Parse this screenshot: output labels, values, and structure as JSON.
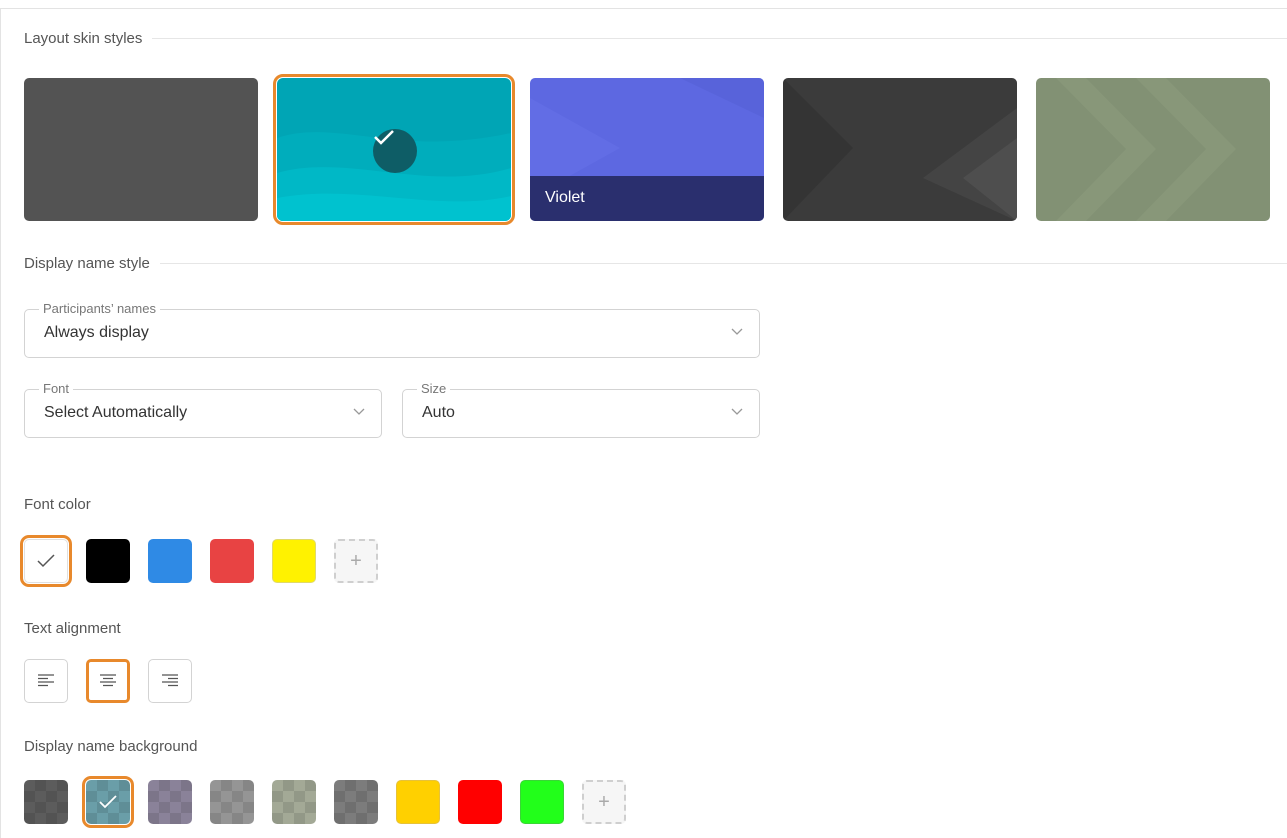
{
  "sections": {
    "layout_skin_styles": "Layout skin styles",
    "display_name_style": "Display name style",
    "font_color": "Font color",
    "text_alignment": "Text alignment",
    "display_name_background": "Display name background"
  },
  "skins": [
    {
      "color": "#535353",
      "selected": false,
      "caption": ""
    },
    {
      "color": "#00a5b5",
      "selected": true,
      "caption": ""
    },
    {
      "color": "#5d68e1",
      "selected": false,
      "caption": "Violet"
    },
    {
      "color": "#3b3b3b",
      "selected": false,
      "caption": ""
    },
    {
      "color": "#829174",
      "selected": false,
      "caption": ""
    }
  ],
  "participants_names": {
    "legend": "Participants’ names",
    "value": "Always display"
  },
  "font": {
    "legend": "Font",
    "value": "Select Automatically"
  },
  "size": {
    "legend": "Size",
    "value": "Auto"
  },
  "font_colors": [
    "#ffffff",
    "#000000",
    "#2f8ae5",
    "#e84343",
    "#fff200"
  ],
  "font_color_selected": 0,
  "alignment_options": [
    "left",
    "center",
    "right"
  ],
  "alignment_selected": "center",
  "background_colors": [
    "#5c5c5c",
    "#6a9ea8",
    "#8a8299",
    "#959595",
    "#a3a996",
    "#7c7c7c",
    "#ffd000",
    "#ff0000",
    "#22ff1a"
  ],
  "background_selected": 1,
  "add_label": "+",
  "accent_color": "#e8892c"
}
